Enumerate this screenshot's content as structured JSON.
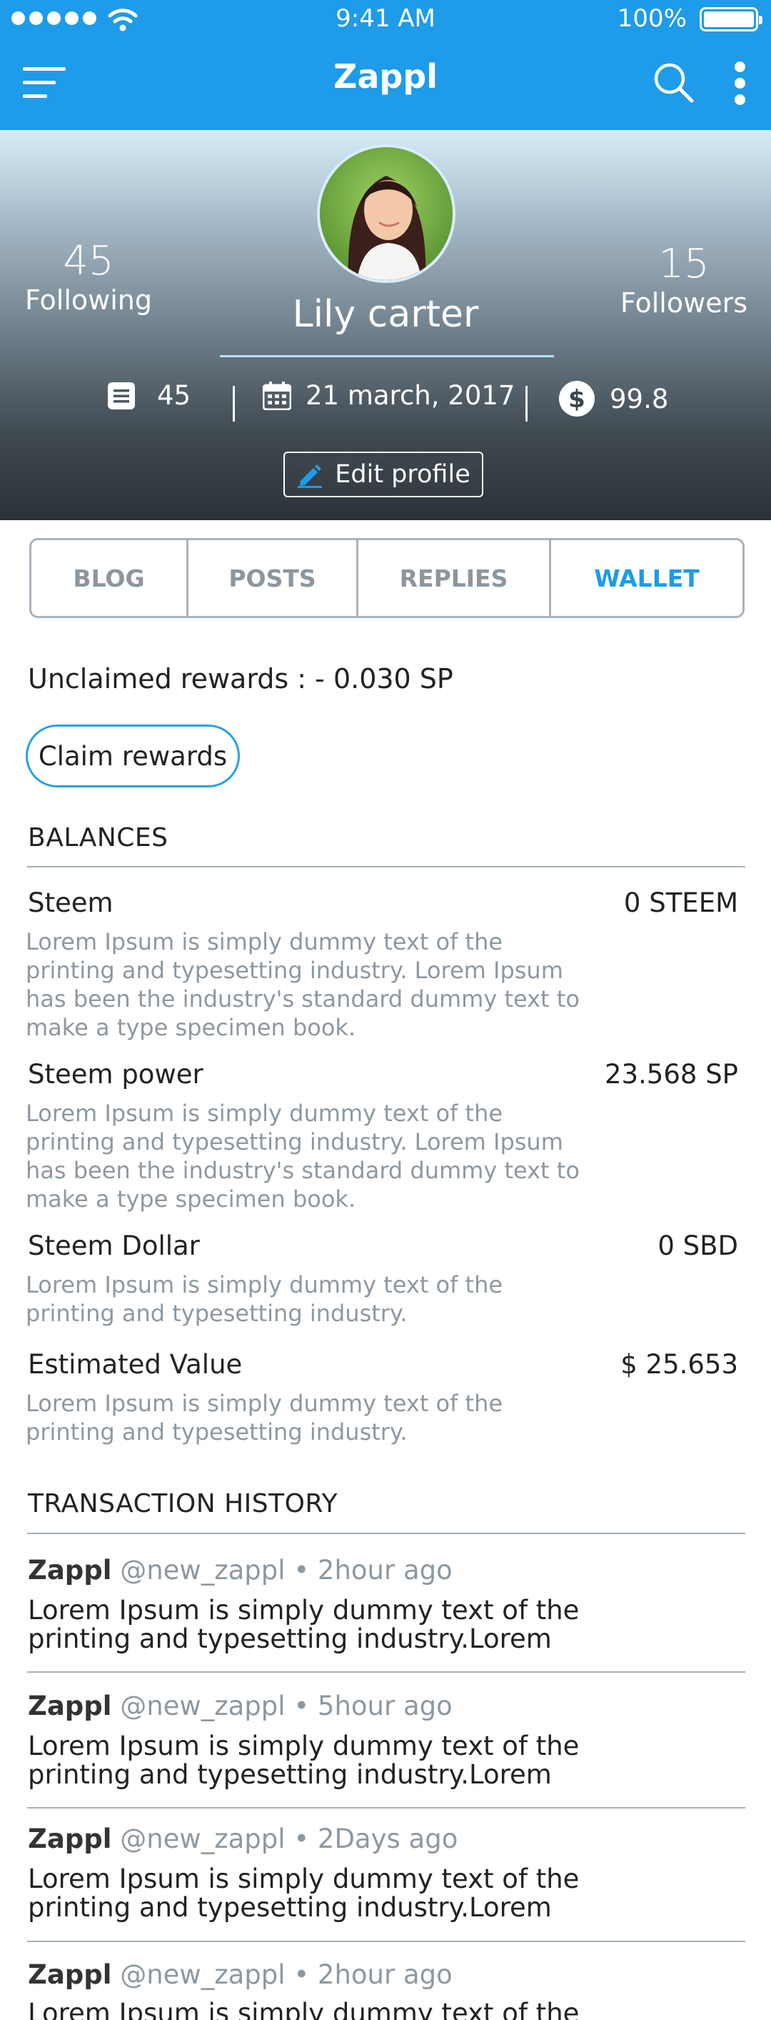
{
  "status_bar": {
    "time": "9:41 AM",
    "battery": "100%"
  },
  "app_bar": {
    "title": "Zappl"
  },
  "profile": {
    "name": "Lily carter",
    "following_count": "45",
    "following_label": "Following",
    "followers_count": "15",
    "followers_label": "Followers",
    "posts_count": "45",
    "joined_date": "21 march, 2017",
    "balance": "99.8",
    "edit_label": "Edit profile"
  },
  "tabs": [
    {
      "label": "BLOG",
      "active": false
    },
    {
      "label": "POSTS",
      "active": false
    },
    {
      "label": "REPLIES",
      "active": false
    },
    {
      "label": "WALLET",
      "active": true
    }
  ],
  "wallet": {
    "unclaimed": "Unclaimed rewards : - 0.030 SP",
    "claim_label": "Claim rewards",
    "balances_title": "BALANCES",
    "balances": [
      {
        "name": "Steem",
        "value": "0 STEEM",
        "desc": "Lorem Ipsum is simply dummy text of the printing and typesetting industry. Lorem Ipsum has been the industry's standard dummy text to make a type specimen book."
      },
      {
        "name": "Steem power",
        "value": "23.568 SP",
        "desc": "Lorem Ipsum is simply dummy text of the printing and typesetting industry. Lorem Ipsum has been the industry's standard dummy text to make a type specimen book."
      },
      {
        "name": "Steem Dollar",
        "value": "0 SBD",
        "desc": "Lorem Ipsum is simply dummy text of the printing and typesetting industry."
      },
      {
        "name": "Estimated Value",
        "value": "$ 25.653",
        "desc": "Lorem Ipsum is simply dummy text of the printing and typesetting industry."
      }
    ],
    "history_title": "TRANSACTION HISTORY",
    "transactions": [
      {
        "user": "Zappl",
        "handle": "@new_zappl",
        "time": "• 2hour ago",
        "text": "Lorem Ipsum is simply dummy text of the printing and typesetting industry.Lorem"
      },
      {
        "user": "Zappl",
        "handle": "@new_zappl",
        "time": "• 5hour ago",
        "text": "Lorem Ipsum is simply dummy text of the printing and typesetting industry.Lorem"
      },
      {
        "user": "Zappl",
        "handle": "@new_zappl",
        "time": "• 2Days ago",
        "text": "Lorem Ipsum is simply dummy text of the printing and typesetting industry.Lorem"
      },
      {
        "user": "Zappl",
        "handle": "@new_zappl",
        "time": "• 2hour ago",
        "text": "Lorem Ipsum is simply dummy text of the"
      }
    ]
  },
  "colors": {
    "primary": "#1e9be9",
    "muted_text": "#8e98a0",
    "divider": "#a6b0b8"
  },
  "icons": [
    "signal-dots-icon",
    "wifi-icon",
    "battery-icon",
    "menu-icon",
    "search-icon",
    "more-vertical-icon",
    "posts-icon",
    "calendar-icon",
    "dollar-icon",
    "pencil-icon"
  ]
}
